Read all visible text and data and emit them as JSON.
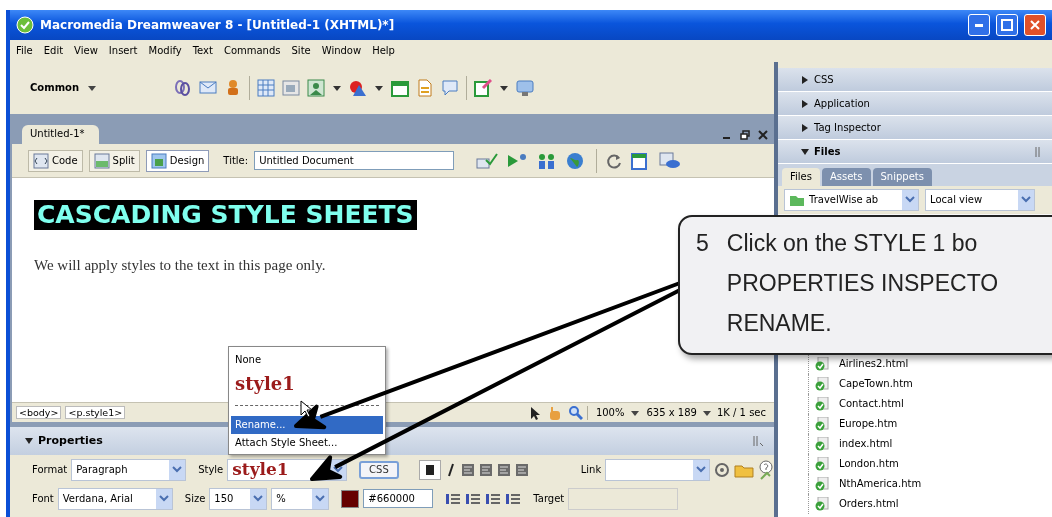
{
  "window": {
    "title": "Macromedia Dreamweaver 8 - [Untitled-1 (XHTML)*]"
  },
  "menu": [
    "File",
    "Edit",
    "View",
    "Insert",
    "Modify",
    "Text",
    "Commands",
    "Site",
    "Window",
    "Help"
  ],
  "insert_bar": {
    "category": "Common"
  },
  "document": {
    "tab": "Untitled-1*",
    "view_buttons": [
      {
        "label": "Code",
        "selected": false
      },
      {
        "label": "Split",
        "selected": false
      },
      {
        "label": "Design",
        "selected": true
      }
    ],
    "title_label": "Title:",
    "title_value": "Untitled Document",
    "heading": "CASCADING STYLE SHEETS",
    "paragraph": "We will apply styles to the text in this page only."
  },
  "status_bar": {
    "tags": [
      "<body>",
      "<p.style1>"
    ],
    "zoom": "100%",
    "size": "635 x 189",
    "download": "1K / 1 sec"
  },
  "style_menu": {
    "items": [
      {
        "kind": "item",
        "label": "None",
        "selected": false
      },
      {
        "kind": "style",
        "label": "style1",
        "selected": false
      },
      {
        "kind": "separator"
      },
      {
        "kind": "item",
        "label": "Rename...",
        "selected": true
      },
      {
        "kind": "item",
        "label": "Attach Style Sheet...",
        "selected": false
      }
    ]
  },
  "properties": {
    "title": "Properties",
    "format_label": "Format",
    "format": "Paragraph",
    "style_label": "Style",
    "style": "style1",
    "css_button": "CSS",
    "link_label": "Link",
    "font_label": "Font",
    "font": "Verdana, Arial",
    "size_label": "Size",
    "size": "150",
    "size_unit": "%",
    "color_value": "#660000",
    "target_label": "Target"
  },
  "panels": [
    {
      "title": "CSS",
      "expanded": false
    },
    {
      "title": "Application",
      "expanded": false
    },
    {
      "title": "Tag Inspector",
      "expanded": false
    },
    {
      "title": "Files",
      "expanded": true
    }
  ],
  "files_tabs": [
    {
      "label": "Files",
      "selected": true
    },
    {
      "label": "Assets",
      "selected": false
    },
    {
      "label": "Snippets",
      "selected": false
    }
  ],
  "site": "TravelWise ab",
  "view": "Local view",
  "files": [
    "Airlines2.html",
    "CapeTown.htm",
    "Contact.html",
    "Europe.htm",
    "index.html",
    "London.htm",
    "NthAmerica.htm",
    "Orders.html"
  ],
  "callout": {
    "step": "5",
    "lines": [
      "Click on the STYLE 1 bo",
      "PROPERTIES INSPECTO",
      "RENAME."
    ]
  }
}
